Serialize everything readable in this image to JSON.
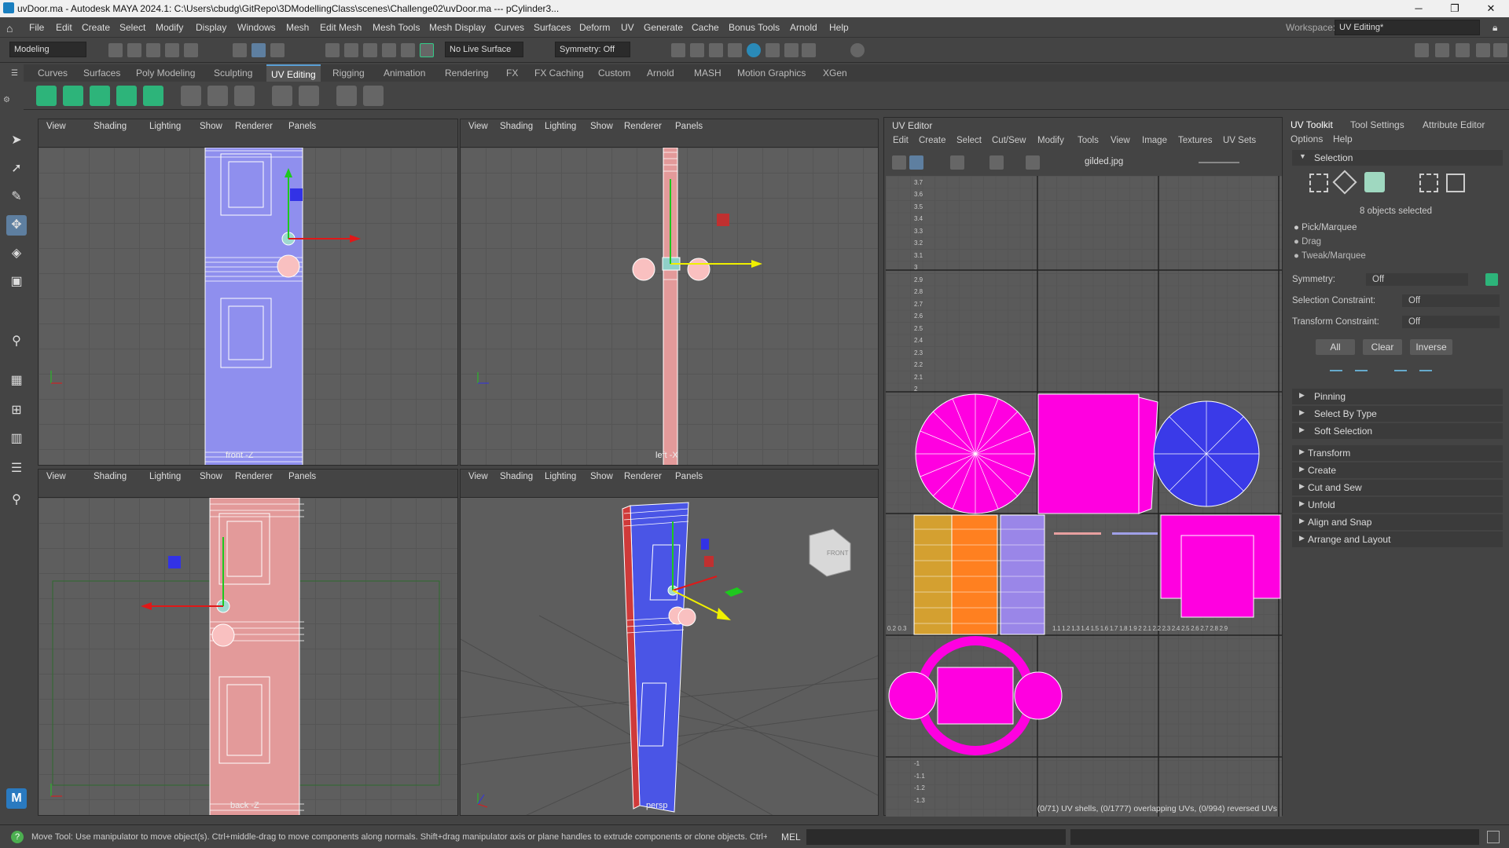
{
  "window": {
    "title": "uvDoor.ma - Autodesk MAYA 2024.1: C:\\Users\\cbudg\\GitRepo\\3DModellingClass\\scenes\\Challenge02\\uvDoor.ma   ---   pCylinder3...",
    "minimize": "─",
    "maximize": "❐",
    "close": "✕"
  },
  "menubar": {
    "items": [
      "File",
      "Edit",
      "Create",
      "Select",
      "Modify",
      "Display",
      "Windows",
      "Mesh",
      "Edit Mesh",
      "Mesh Tools",
      "Mesh Display",
      "Curves",
      "Surfaces",
      "Deform",
      "UV",
      "Generate",
      "Cache",
      "Bonus Tools",
      "Arnold",
      "Help"
    ],
    "workspace_label": "Workspace:",
    "workspace_value": "UV Editing*"
  },
  "statusline": {
    "menuset": "Modeling",
    "live_surface": "No Live Surface",
    "symmetry": "Symmetry: Off"
  },
  "shelf": {
    "tabs": [
      "Curves",
      "Surfaces",
      "Poly Modeling",
      "Sculpting",
      "UV Editing",
      "Rigging",
      "Animation",
      "Rendering",
      "FX",
      "FX Caching",
      "Custom",
      "Arnold",
      "MASH",
      "Motion Graphics",
      "XGen"
    ],
    "active": "UV Editing"
  },
  "viewport_menu": [
    "View",
    "Shading",
    "Lighting",
    "Show",
    "Renderer",
    "Panels"
  ],
  "viewports": [
    {
      "camera": "front -Z"
    },
    {
      "camera": "left -X"
    },
    {
      "camera": "back -Z"
    },
    {
      "camera": "persp"
    }
  ],
  "cube_label": "FRONT",
  "uv_editor": {
    "title": "UV Editor",
    "menu": [
      "Edit",
      "Create",
      "Select",
      "Cut/Sew",
      "Modify",
      "Tools",
      "View",
      "Image",
      "Textures",
      "UV Sets"
    ],
    "texture": "gilded.jpg",
    "status": "(0/71) UV shells, (0/1777) overlapping UVs, (0/994) reversed UVs",
    "v_ticks_top": [
      "3.7",
      "3.6",
      "3.5",
      "3.4",
      "3.3",
      "3.2",
      "3.1",
      "3"
    ],
    "v_ticks_mid": [
      "2.9",
      "2.8",
      "2.7",
      "2.6",
      "2.5",
      "2.4",
      "2.3",
      "2.2",
      "2.1",
      "2"
    ],
    "v_ticks_bot": [
      "-1",
      "-1.1",
      "-1.2",
      "-1.3"
    ],
    "u_ticks": "1.1 1.2 1.3 1.4 1.5 1.6 1.7 1.8 1.9 2   2.1 2.2 2.3 2.4 2.5 2.6 2.7 2.8 2.9",
    "u_ticks_left": "0.2 0.3"
  },
  "toolkit": {
    "tabs": [
      "UV Toolkit",
      "Tool Settings",
      "Attribute Editor"
    ],
    "menu": [
      "Options",
      "Help"
    ],
    "selection_header": "Selection",
    "selected_count": "8 objects selected",
    "modes": [
      "Pick/Marquee",
      "Drag",
      "Tweak/Marquee"
    ],
    "symmetry_label": "Symmetry:",
    "symmetry_value": "Off",
    "sel_constraint_label": "Selection Constraint:",
    "sel_constraint_value": "Off",
    "xf_constraint_label": "Transform Constraint:",
    "xf_constraint_value": "Off",
    "buttons": [
      "All",
      "Clear",
      "Inverse"
    ],
    "sections": [
      "Pinning",
      "Select By Type",
      "Soft Selection",
      "Transform",
      "Create",
      "Cut and Sew",
      "Unfold",
      "Align and Snap",
      "Arrange and Layout"
    ]
  },
  "helpline": {
    "text": "Move Tool: Use manipulator to move object(s). Ctrl+middle-drag to move components along normals. Shift+drag manipulator axis or plane handles to extrude components or clone objects. Ctrl+Shift+drag to cons",
    "mel": "MEL"
  },
  "colors": {
    "magenta": "#ff00e0",
    "blue_uv": "#3a3ae8",
    "door_front": "#8f8fee",
    "door_back": "#e39a9a",
    "persp_door": "#4a55e6",
    "accent": "#5aa0d6"
  }
}
